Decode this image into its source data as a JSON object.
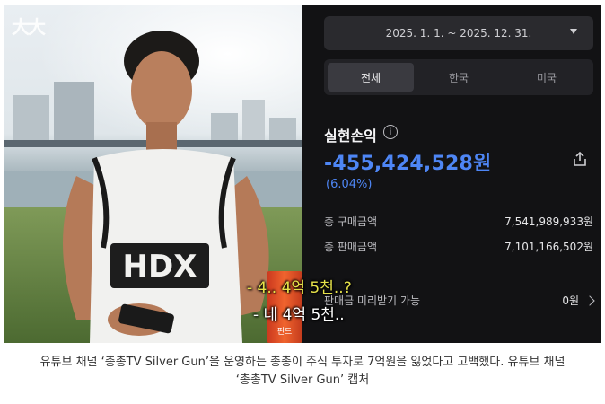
{
  "video": {
    "logo": "大大",
    "subtitle_1": "- 4.. 4억 5천..?",
    "subtitle_2": "- 네 4억 5천..",
    "shirt_text": "HDX",
    "can_label": "핀드"
  },
  "panel": {
    "date_range": "2025. 1. 1. ~ 2025. 12. 31.",
    "tabs": [
      {
        "label": "전체",
        "active": true
      },
      {
        "label": "한국",
        "active": false
      },
      {
        "label": "미국",
        "active": false
      }
    ],
    "title": "실현손익",
    "info_glyph": "i",
    "amount": "-455,424,528원",
    "percent": "(6.04%)",
    "rows": [
      {
        "label": "총 구매금액",
        "value": "7,541,989,933원"
      },
      {
        "label": "총 판매금액",
        "value": "7,101,166,502원"
      },
      {
        "label": "판매금 미리받기 가능",
        "value": "0원"
      }
    ],
    "accent_color": "#4e86f5"
  },
  "caption": {
    "line1": "유튜브 채널 ‘총총TV Silver Gun’을 운영하는 총총이 주식 투자로 7억원을 잃었다고 고백했다. 유튜브 채널",
    "line2": "‘총총TV Silver Gun’ 캡처"
  }
}
